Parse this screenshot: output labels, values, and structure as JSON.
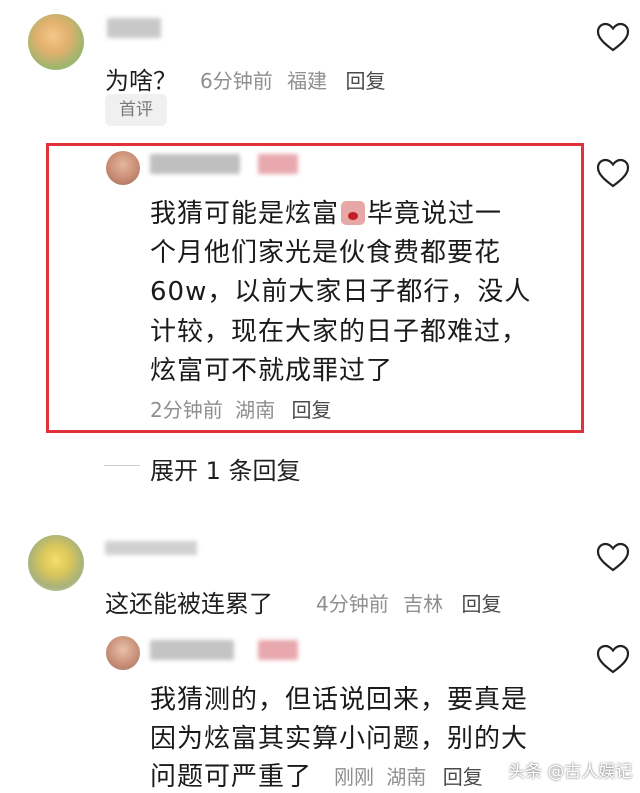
{
  "comments": [
    {
      "text": "为啥？",
      "time": "6分钟前",
      "location": "福建",
      "reply_label": "回复",
      "badge": "首评"
    },
    {
      "text_lines": [
        "我猜可能是炫富",
        "毕竟说过一",
        "个月他们家光是伙食费都要花",
        "60w，以前大家日子都行，没人",
        "计较，现在大家的日子都难过，",
        "炫富可不就成罪过了"
      ],
      "time": "2分钟前",
      "location": "湖南",
      "reply_label": "回复"
    },
    {
      "expand_label": "展开 1 条回复"
    },
    {
      "text": "这还能被连累了",
      "time": "4分钟前",
      "location": "吉林",
      "reply_label": "回复"
    },
    {
      "text_lines": [
        "我猜测的，但话说回来，要真是",
        "因为炫富其实算小问题，别的大",
        "问题可严重了"
      ],
      "time": "刚刚",
      "location": "湖南",
      "reply_label": "回复"
    }
  ],
  "watermark": "头条 @古人娱记",
  "colors": {
    "highlight_border": "#e0323a",
    "meta_text": "#8f8f8f",
    "heart_stroke": "#222222"
  },
  "icons": [
    "avatar",
    "heart-icon",
    "emoji-icon"
  ]
}
